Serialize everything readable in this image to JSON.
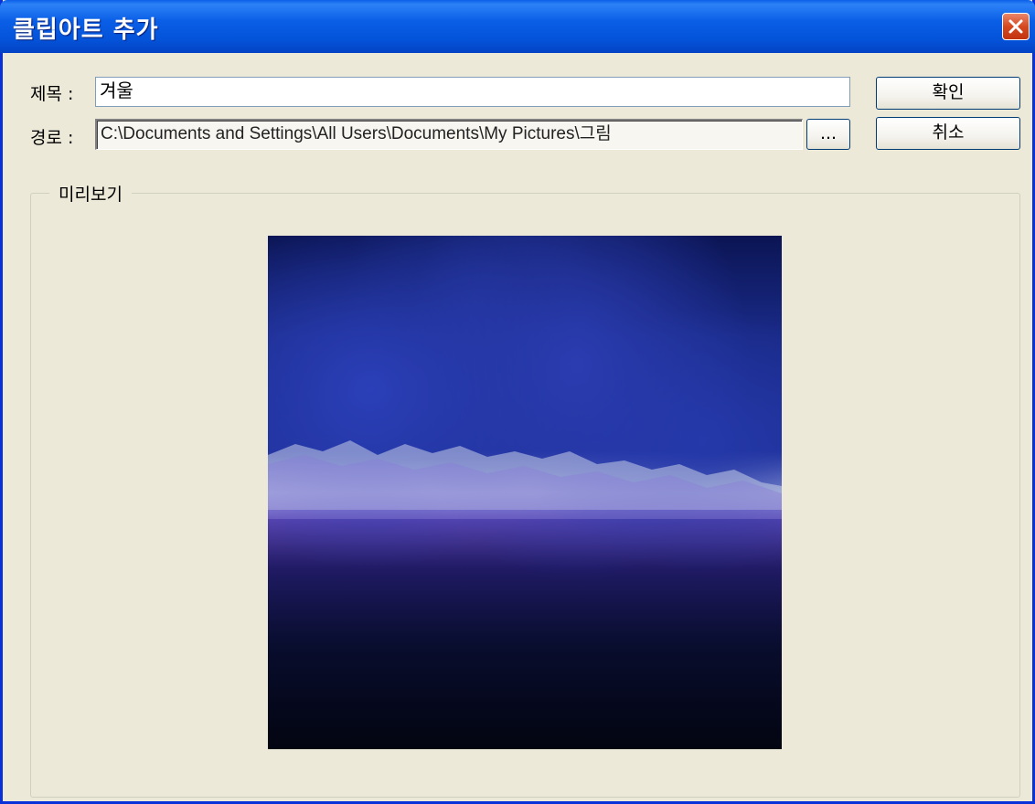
{
  "window": {
    "title": "클립아트 추가"
  },
  "form": {
    "title_label": "제목 :",
    "title_value": "겨울",
    "path_label": "경로 :",
    "path_value": "C:\\Documents and Settings\\All Users\\Documents\\My Pictures\\그림",
    "browse_label": "..."
  },
  "buttons": {
    "ok_label": "확인",
    "cancel_label": "취소"
  },
  "preview": {
    "group_label": "미리보기"
  },
  "colors": {
    "titlebar": "#0453d9",
    "dialog_bg": "#ece9d8",
    "close_button": "#d5491f"
  }
}
